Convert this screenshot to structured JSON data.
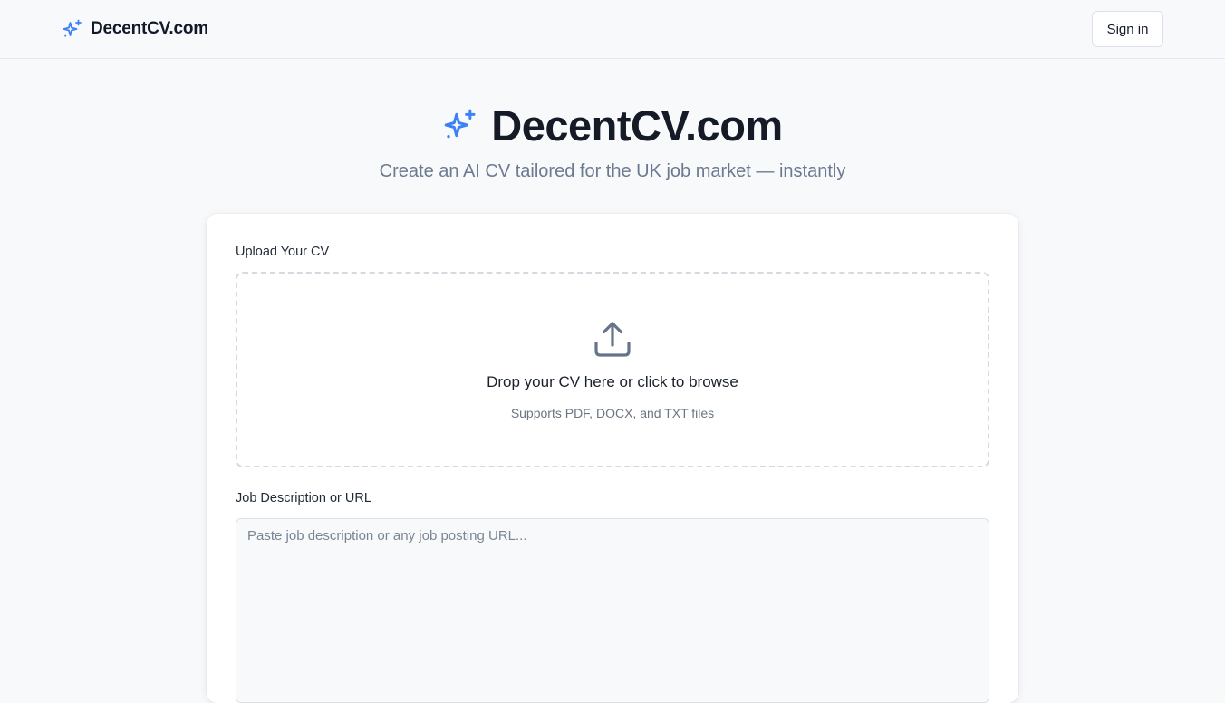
{
  "header": {
    "brand_name": "DecentCV.com",
    "brand_icon": "sparkles-icon",
    "signin_label": "Sign in"
  },
  "hero": {
    "title": "DecentCV.com",
    "subtitle": "Create an AI CV tailored for the UK job market — instantly"
  },
  "form": {
    "upload_label": "Upload Your CV",
    "dropzone_text": "Drop your CV here or click to browse",
    "dropzone_hint": "Supports PDF, DOCX, and TXT files",
    "job_label": "Job Description or URL",
    "job_placeholder": "Paste job description or any job posting URL...",
    "job_value": ""
  },
  "colors": {
    "accent": "#3b82f6",
    "background": "#f8f9fb",
    "text_primary": "#111827",
    "text_muted": "#6b7a90"
  }
}
